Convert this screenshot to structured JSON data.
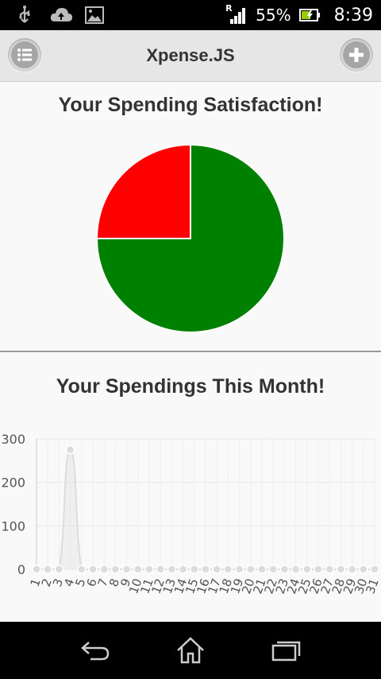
{
  "status_bar": {
    "roaming": "R",
    "battery": "55%",
    "time": "8:39",
    "icons": [
      "usb-icon",
      "cloud-upload-icon",
      "image-icon",
      "signal-icon",
      "battery-icon"
    ]
  },
  "header": {
    "title": "Xpense.JS",
    "left_button": "list-icon",
    "right_button": "add-icon"
  },
  "satisfaction": {
    "title": "Your Spending Satisfaction!"
  },
  "spendings": {
    "title": "Your Spendings This Month!"
  },
  "colors": {
    "pie_red": "#ff0000",
    "pie_green": "#008000",
    "line": "#dcdcdc"
  },
  "chart_data": [
    {
      "type": "pie",
      "title": "",
      "values": [
        75,
        25
      ],
      "colors": [
        "#008000",
        "#ff0000"
      ]
    },
    {
      "type": "line",
      "title": "",
      "xlabel": "",
      "ylabel": "",
      "x": [
        "1",
        "2",
        "3",
        "4",
        "5",
        "6",
        "7",
        "8",
        "9",
        "10",
        "11",
        "12",
        "13",
        "14",
        "15",
        "16",
        "17",
        "18",
        "19",
        "20",
        "21",
        "22",
        "23",
        "24",
        "25",
        "26",
        "27",
        "28",
        "29",
        "30",
        "31"
      ],
      "values": [
        0,
        0,
        0,
        275,
        0,
        0,
        0,
        0,
        0,
        0,
        0,
        0,
        0,
        0,
        0,
        0,
        0,
        0,
        0,
        0,
        0,
        0,
        0,
        0,
        0,
        0,
        0,
        0,
        0,
        0,
        0
      ],
      "y_ticks": [
        "0",
        "100",
        "200",
        "300"
      ],
      "ylim": [
        0,
        300
      ],
      "grid": true
    }
  ]
}
